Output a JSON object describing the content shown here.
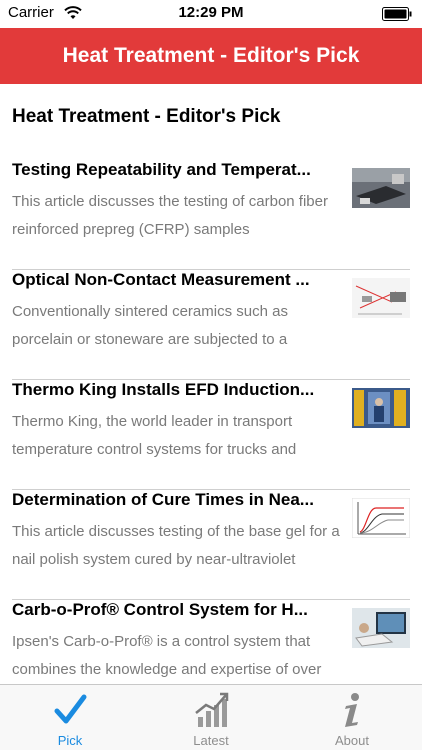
{
  "status_bar": {
    "carrier": "Carrier",
    "time": "12:29 PM"
  },
  "navbar": {
    "title": "Heat Treatment - Editor's Pick",
    "color": "#e23a3a"
  },
  "section": {
    "heading": "Heat Treatment - Editor's Pick"
  },
  "articles": [
    {
      "title": "Testing Repeatability and Temperat...",
      "description": "This article discusses the testing of carbon fiber reinforced prepreg (CFRP) samples",
      "thumbnail": "lab-equipment-photo"
    },
    {
      "title": "Optical Non-Contact Measurement ...",
      "description": "Conventionally sintered ceramics such as porcelain or stoneware are subjected to a",
      "thumbnail": "measurement-diagram"
    },
    {
      "title": "Thermo King Installs EFD Induction...",
      "description": "Thermo King, the world leader in transport temperature control systems for trucks and",
      "thumbnail": "induction-machine-photo"
    },
    {
      "title": "Determination of Cure Times in Nea...",
      "description": "This article discusses testing of the base gel for a nail polish system cured by near-ultraviolet",
      "thumbnail": "cure-time-graph"
    },
    {
      "title": "Carb-o-Prof® Control System for H...",
      "description": "Ipsen's Carb-o-Prof® is a control system that combines the knowledge and expertise of over",
      "thumbnail": "control-system-photo"
    }
  ],
  "tabbar": {
    "tabs": [
      {
        "label": "Pick",
        "icon": "checkmark-icon",
        "active": true
      },
      {
        "label": "Latest",
        "icon": "chart-icon",
        "active": false
      },
      {
        "label": "About",
        "icon": "info-icon",
        "active": false
      }
    ],
    "active_color": "#1a8be0"
  }
}
